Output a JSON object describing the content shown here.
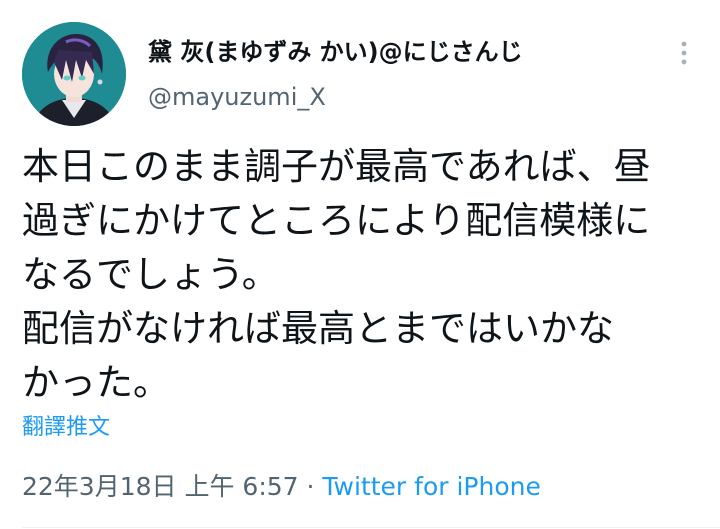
{
  "author": {
    "display_name": "黛 灰(まゆずみ かい)@にじさんじ",
    "handle": "@mayuzumi_X",
    "avatar_icon": "character-avatar",
    "avatar_bg": "#1f8c93"
  },
  "tweet": {
    "lines": [
      "本日このまま調子が最高であれば、昼",
      "過ぎにかけてところにより配信模様に",
      "なるでしょう。",
      "配信がなければ最高とまではいかな",
      "かった。"
    ],
    "translate_label": "翻譯推文"
  },
  "meta": {
    "timestamp": "22年3月18日 上午 6:57",
    "separator": " · ",
    "source": "Twitter for iPhone"
  },
  "menu": {
    "icon": "more-vertical-icon"
  },
  "colors": {
    "text": "#0f1419",
    "secondary": "#536471",
    "link": "#1d9bf0"
  }
}
